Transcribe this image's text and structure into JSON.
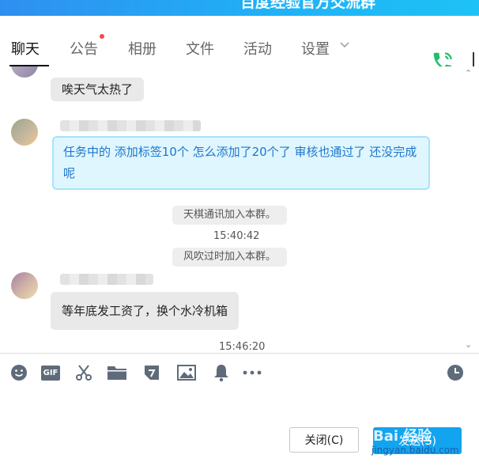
{
  "window": {
    "title": "百度经验官方交流群"
  },
  "tabs": [
    {
      "label": "聊天"
    },
    {
      "label": "公告"
    },
    {
      "label": "相册"
    },
    {
      "label": "文件"
    },
    {
      "label": "活动"
    },
    {
      "label": "设置"
    }
  ],
  "messages": {
    "m1": {
      "text": "唉天气太热了"
    },
    "m2": {
      "text": "任务中的 添加标签10个 怎么添加了20个了 审核也通过了 还没完成呢"
    },
    "sys1": {
      "text": "天棋通讯加入本群。"
    },
    "time1": {
      "text": "15:40:42"
    },
    "sys2": {
      "text": "风吹过时加入本群。"
    },
    "m3": {
      "text": "等年底发工资了，换个水冷机箱"
    },
    "time2": {
      "text": "15:46:20"
    }
  },
  "toolbar": {
    "icons": [
      "emoji-icon",
      "gif-icon",
      "scissors-icon",
      "folder-icon",
      "sticker-icon",
      "image-icon",
      "bell-icon",
      "more-icon",
      "history-clock-icon"
    ],
    "gif_label": "GIF"
  },
  "actions": {
    "close_label": "关闭(C)",
    "send_label": "发送(S)"
  },
  "watermark": {
    "text": "Bai 经验",
    "sub": "jingyan.baidu.com"
  },
  "colors": {
    "accent": "#13a4f0",
    "title_bar": "#20b0f6",
    "badge": "#f24a4a",
    "phone": "#1fbf6a"
  }
}
